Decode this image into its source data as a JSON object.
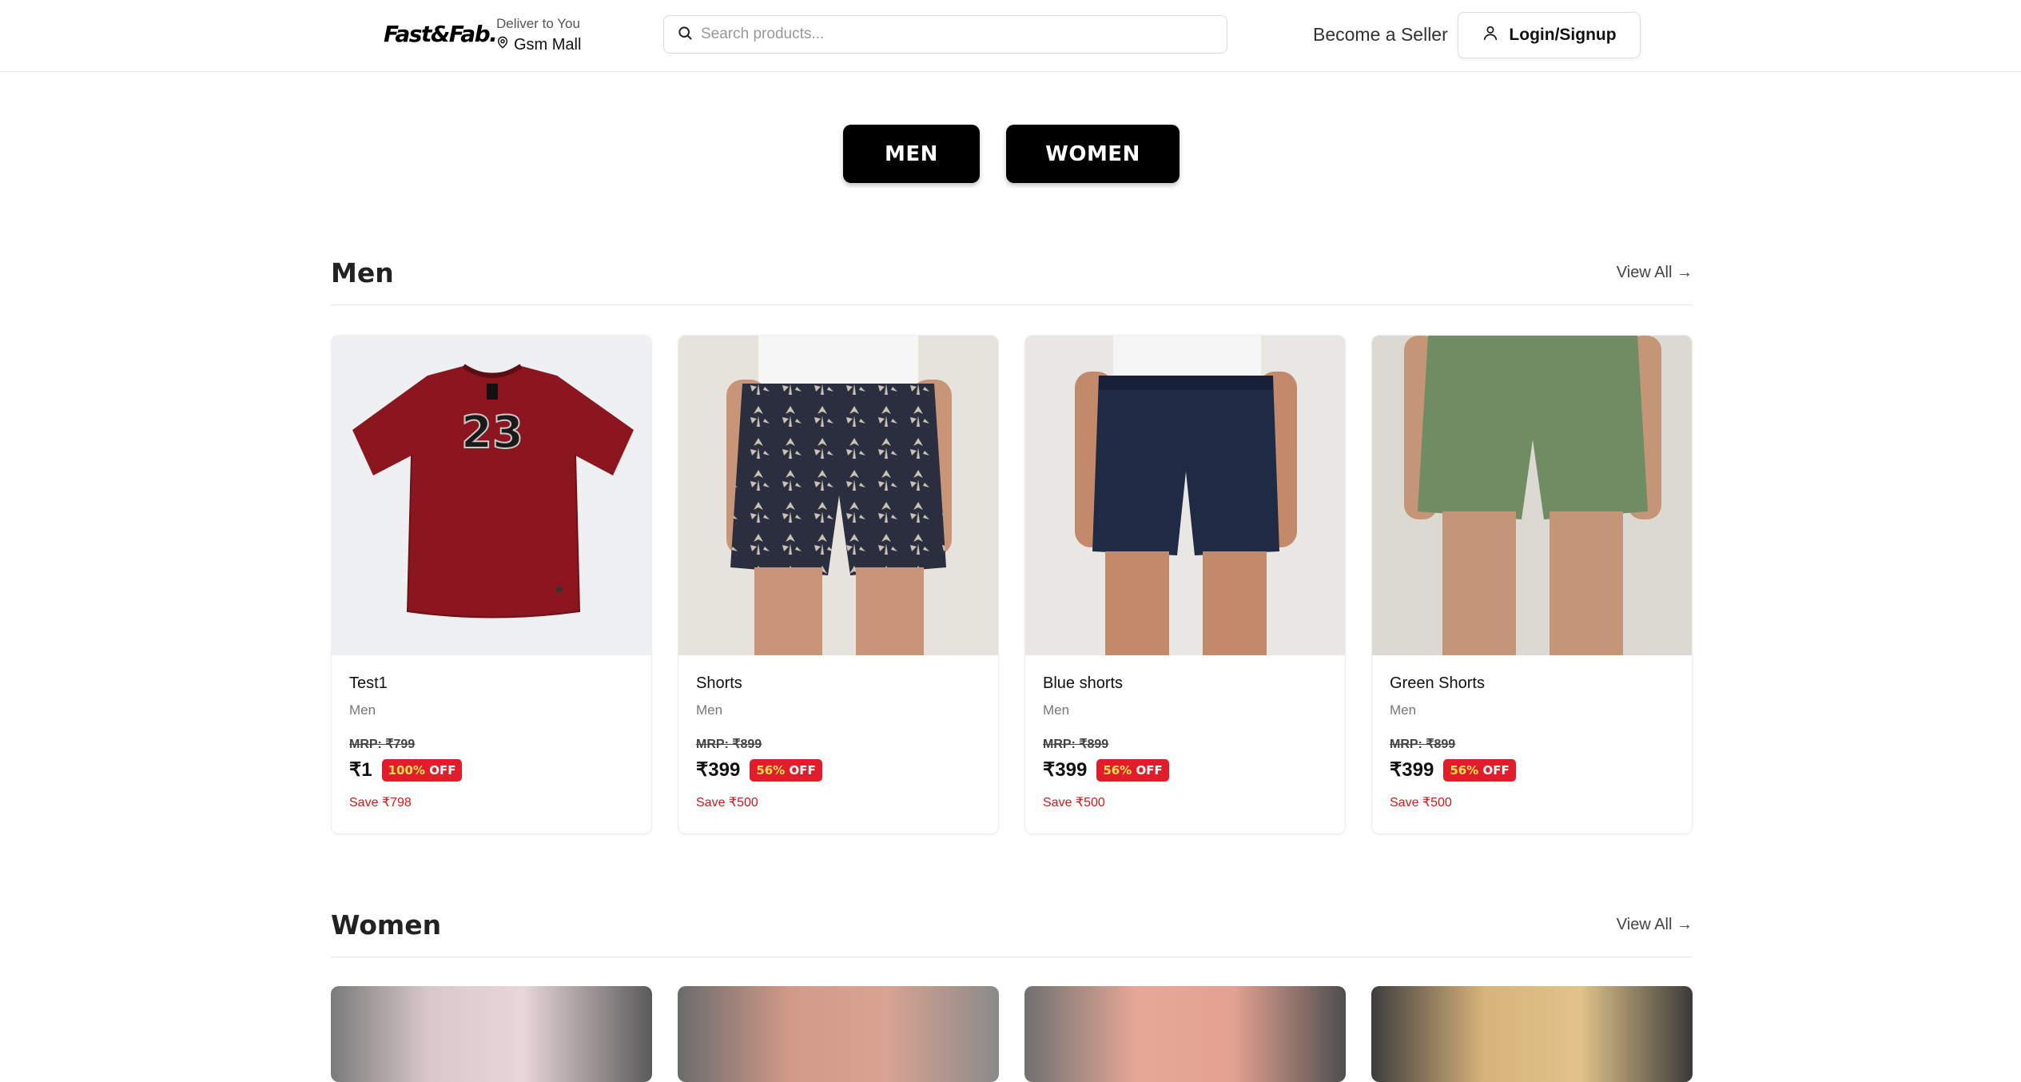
{
  "header": {
    "logo": "Fast&Fab.",
    "deliver_label": "Deliver to You",
    "deliver_location": "Gsm Mall",
    "search_placeholder": "Search products...",
    "seller_link": "Become a Seller",
    "login_label": "Login/Signup"
  },
  "categories": [
    "MEN",
    "WOMEN"
  ],
  "sections": [
    {
      "title": "Men",
      "view_all": "View All →",
      "products": [
        {
          "name": "Test1",
          "category": "Men",
          "mrp": "MRP: ₹799",
          "price": "₹1",
          "discount_pct": "100%",
          "discount_word": "OFF",
          "save": "Save ₹798"
        },
        {
          "name": "Shorts",
          "category": "Men",
          "mrp": "MRP: ₹899",
          "price": "₹399",
          "discount_pct": "56%",
          "discount_word": "OFF",
          "save": "Save ₹500"
        },
        {
          "name": "Blue shorts",
          "category": "Men",
          "mrp": "MRP: ₹899",
          "price": "₹399",
          "discount_pct": "56%",
          "discount_word": "OFF",
          "save": "Save ₹500"
        },
        {
          "name": "Green Shorts",
          "category": "Men",
          "mrp": "MRP: ₹899",
          "price": "₹399",
          "discount_pct": "56%",
          "discount_word": "OFF",
          "save": "Save ₹500"
        }
      ]
    },
    {
      "title": "Women",
      "view_all": "View All →"
    }
  ],
  "icons": {
    "location": "map-pin-icon",
    "search": "search-icon",
    "user": "user-icon"
  },
  "colors": {
    "discount_badge": "#e11d2b",
    "discount_text": "#ffe14a",
    "save_text": "#d31818",
    "category_button": "#000000"
  }
}
